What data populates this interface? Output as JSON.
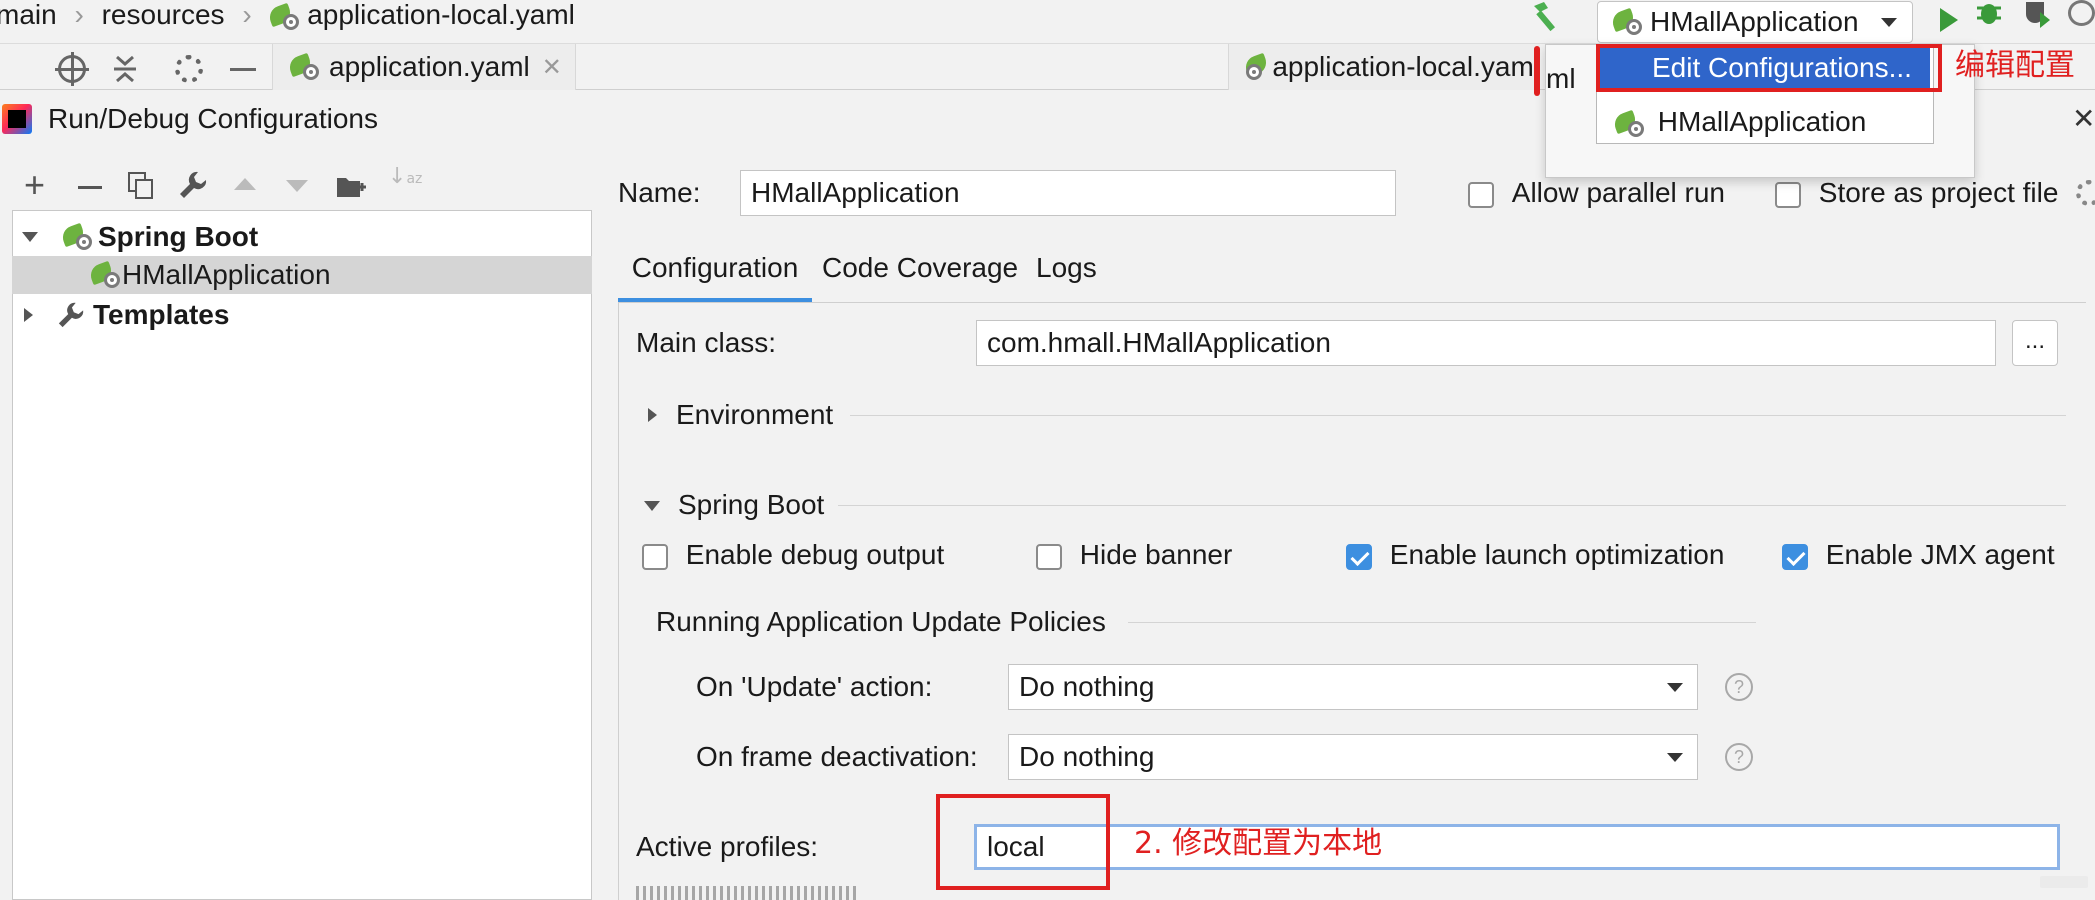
{
  "breadcrumb": {
    "items": [
      "main",
      "resources",
      "application-local.yaml"
    ]
  },
  "editor_tabs": [
    {
      "label": "application.yaml"
    },
    {
      "label": "application-local.yaml"
    }
  ],
  "toolbar": {
    "run_config_selected": "HMallApplication"
  },
  "run_dropdown": {
    "items": [
      {
        "label": "Edit Configurations..."
      },
      {
        "label": "HMallApplication"
      }
    ],
    "partial_tab_text": "ml"
  },
  "annotations": {
    "edit_config": "编辑配置",
    "modify_profile": "2. 修改配置为本地"
  },
  "dialog": {
    "title": "Run/Debug Configurations",
    "tree": [
      {
        "label": "Spring Boot",
        "expanded": true
      },
      {
        "label": "HMallApplication",
        "selected": true
      },
      {
        "label": "Templates",
        "expanded": false
      }
    ],
    "name_label": "Name:",
    "name_value": "HMallApplication",
    "allow_parallel": {
      "label": "Allow parallel run",
      "checked": false
    },
    "store_project": {
      "label": "Store as project file",
      "checked": false
    },
    "tabs": [
      {
        "label": "Configuration",
        "active": true
      },
      {
        "label": "Code Coverage"
      },
      {
        "label": "Logs"
      }
    ],
    "main_class_label": "Main class:",
    "main_class_value": "com.hmall.HMallApplication",
    "browse_label": "...",
    "environment_label": "Environment",
    "spring_boot_section": "Spring Boot",
    "options": [
      {
        "label": "Enable debug output",
        "checked": false
      },
      {
        "label": "Hide banner",
        "checked": false
      },
      {
        "label": "Enable launch optimization",
        "checked": true
      },
      {
        "label": "Enable JMX agent",
        "checked": true
      }
    ],
    "policies_title": "Running Application Update Policies",
    "on_update_label": "On 'Update' action:",
    "on_update_value": "Do nothing",
    "on_frame_label": "On frame deactivation:",
    "on_frame_value": "Do nothing",
    "help_glyph": "?",
    "active_profiles_label": "Active profiles:",
    "active_profiles_value": "local"
  },
  "colors": {
    "accent": "#3d8fe0",
    "selection": "#2f65ca",
    "annotation_red": "#e02020",
    "spring_green": "#6db33f"
  }
}
